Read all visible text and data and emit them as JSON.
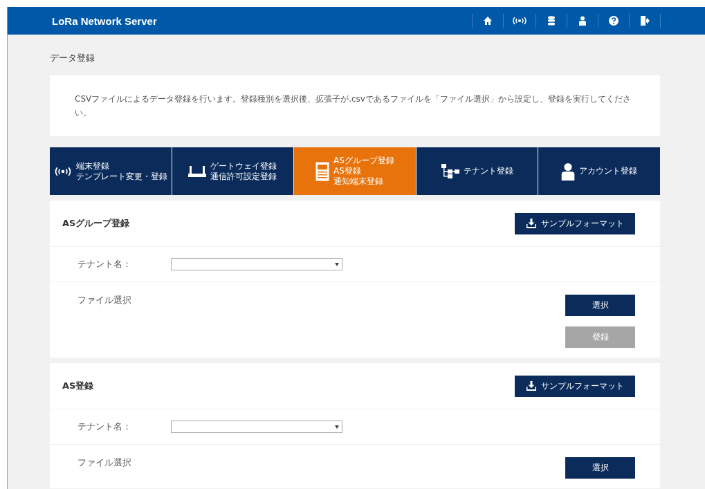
{
  "header": {
    "title": "LoRa Network Server",
    "icons": [
      {
        "kind": "home"
      },
      {
        "kind": "signal"
      },
      {
        "kind": "database"
      },
      {
        "kind": "user"
      },
      {
        "kind": "help"
      },
      {
        "kind": "logout"
      }
    ]
  },
  "page_title": "データ登録",
  "description": "CSVファイルによるデータ登録を行います。登録種別を選択後、拡張子が.csvであるファイルを「ファイル選択」から設定し、登録を実行してください。",
  "tabs": [
    {
      "lines": [
        "端末登録",
        "テンプレート変更・登録"
      ],
      "selected": false
    },
    {
      "lines": [
        "ゲートウェイ登録",
        "通信許可設定登録"
      ],
      "selected": false
    },
    {
      "lines": [
        "ASグループ登録",
        "AS登録",
        "通知端末登録"
      ],
      "selected": true
    },
    {
      "lines": [
        "テナント登録"
      ],
      "selected": false
    },
    {
      "lines": [
        "アカウント登録"
      ],
      "selected": false
    }
  ],
  "sections": [
    {
      "title": "ASグループ登録",
      "sample_button": "サンプルフォーマット",
      "tenant_label": "テナント名：",
      "file_label": "ファイル選択",
      "buttons": [
        {
          "label": "選択",
          "disabled": false
        },
        {
          "label": "登録",
          "disabled": true
        }
      ]
    },
    {
      "title": "AS登録",
      "sample_button": "サンプルフォーマット",
      "tenant_label": "テナント名：",
      "file_label": "ファイル選択",
      "buttons": [
        {
          "label": "選択",
          "disabled": false
        }
      ]
    }
  ]
}
